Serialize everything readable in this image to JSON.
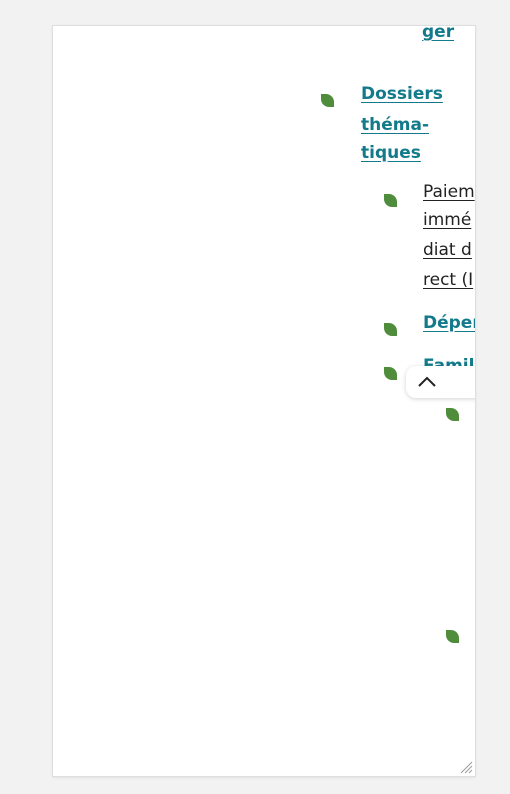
{
  "nav": {
    "top_fragment": "ger",
    "dossiers": [
      "Dossiers",
      "théma-",
      "tiques"
    ],
    "paiement": [
      "Paiem",
      "immé",
      "diat d",
      "rect (I"
    ],
    "depen": "Déper",
    "famil": "Famill"
  },
  "controls": {
    "scroll_top_icon": "chevron-up-icon",
    "resize_icon": "resize-grip-icon"
  },
  "colors": {
    "link": "#127a8a",
    "bullet": "#4f8d3c"
  }
}
